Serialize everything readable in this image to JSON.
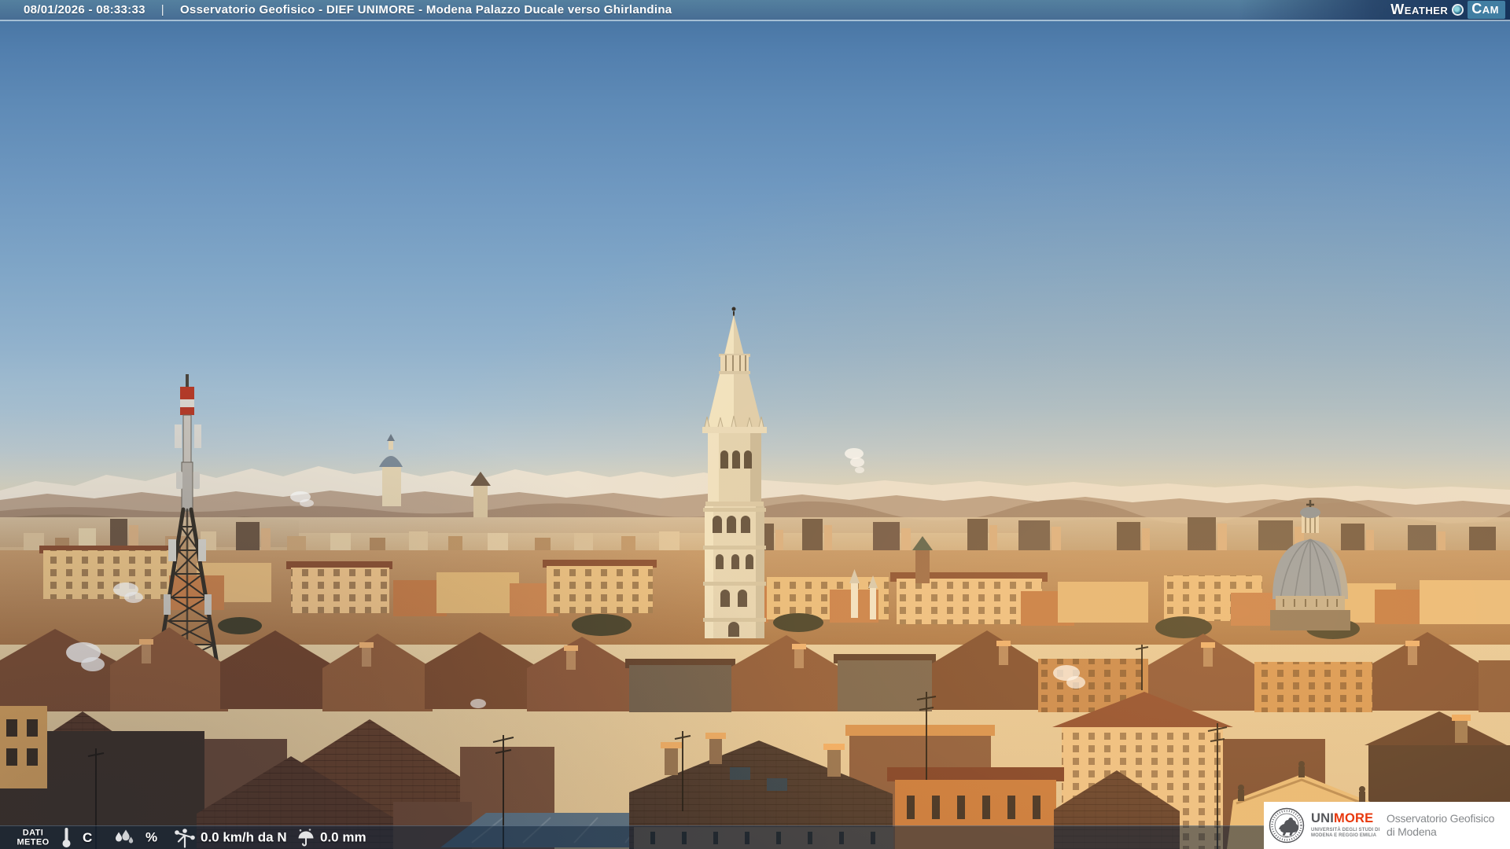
{
  "header": {
    "datetime": "08/01/2026 - 08:33:33",
    "separator": "|",
    "title": "Osservatorio Geofisico - DIEF UNIMORE - Modena Palazzo Ducale verso Ghirlandina",
    "weathercam_weather": "Weather",
    "weathercam_cam": "Cam"
  },
  "meteo_bar": {
    "label_line1": "DATI",
    "label_line2": "METEO",
    "temperature_value": "",
    "temperature_unit": "C",
    "humidity_value": "",
    "humidity_unit": "%",
    "wind_value": "0.0 km/h da N",
    "rain_value": "0.0 mm"
  },
  "logo_box": {
    "brand_uni": "UNI",
    "brand_more": "MORE",
    "brand_sub1": "UNIVERSITÀ DEGLI STUDI DI",
    "brand_sub2": "MODENA E REGGIO EMILIA",
    "obs_line1": "Osservatorio Geofisico",
    "obs_line2": "di Modena"
  },
  "icons": {
    "temperature": "thermometer-icon",
    "humidity": "drops-icon",
    "wind": "anemometer-icon",
    "rain": "umbrella-icon",
    "weathercam": "camera-dot-icon"
  },
  "colors": {
    "header_blue": "#4c7398",
    "header_navy": "#16345a",
    "cam_badge_blue": "#417ea2",
    "unimore_red": "#e8380d",
    "bar_overlay": "rgba(14,34,58,0.52)",
    "logo_gray": "#85888b"
  }
}
